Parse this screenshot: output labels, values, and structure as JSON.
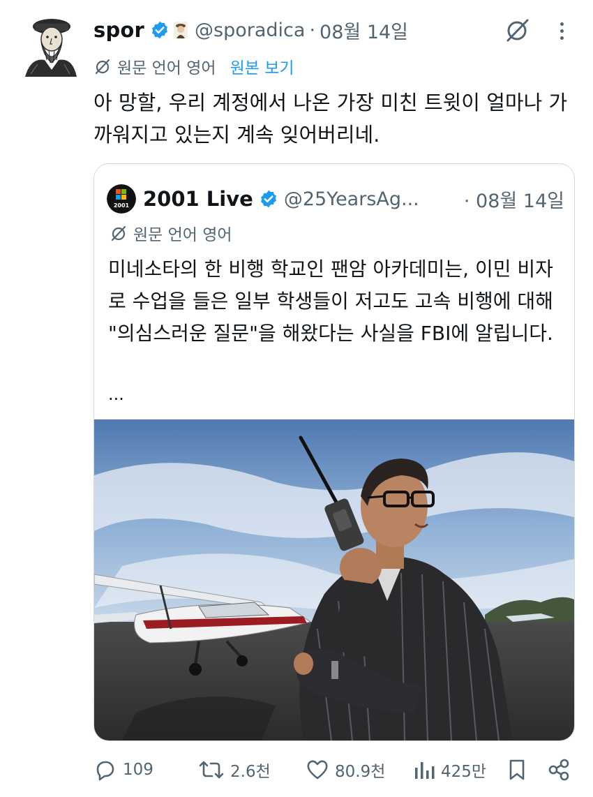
{
  "tweet": {
    "display_name": "spor",
    "handle": "@sporadica",
    "separator": "·",
    "date": "08월 14일",
    "translation_note": "원문 언어 영어",
    "show_original": "원본 보기",
    "text": "아 망할, 우리 계정에서 나온 가장 미친 트윗이 얼마나 가까워지고 있는지 계속 잊어버리네."
  },
  "quote": {
    "display_name": "2001 Live",
    "avatar_label": "2001",
    "handle": "@25YearsAg...",
    "date": "· 08월 14일",
    "translation_note": "원문 언어 영어",
    "text": "미네소타의 한 비행 학교인 팬암 아카데미는, 이민 비자로 수업을 들은 일부 학생들이 저고도 고속 비행에 대해 \"의심스러운 질문\"을 해왔다는 사실을 FBI에 알립니다.",
    "ellipsis": "..."
  },
  "actions": {
    "replies": "109",
    "retweets": "2.6천",
    "likes": "80.9천",
    "views": "425만"
  },
  "icons": {
    "verified": "verified-badge-icon",
    "no_translate": "no-translate-icon",
    "more": "more-dots-icon",
    "reply": "reply-bubble-icon",
    "retweet": "retweet-icon",
    "like": "heart-icon",
    "views": "views-bar-icon",
    "bookmark": "bookmark-icon",
    "share": "share-icon"
  },
  "colors": {
    "accent": "#1d9bf0",
    "text": "#0f1419",
    "muted": "#536471",
    "border": "#cfd9de"
  }
}
